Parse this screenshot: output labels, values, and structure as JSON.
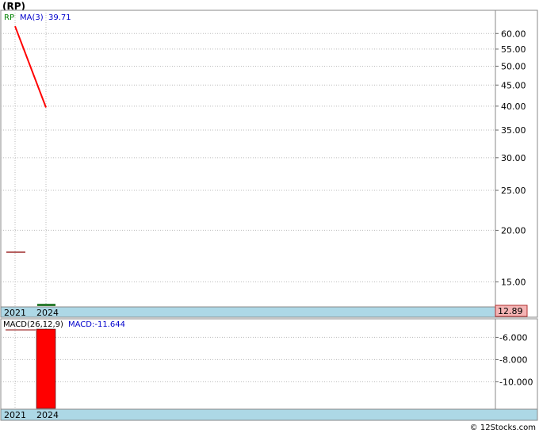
{
  "chart_data": [
    {
      "type": "line",
      "title": "(RP)",
      "legend": {
        "symbol": "RP",
        "ma_label": "MA(3)",
        "ma_value": "39.71"
      },
      "colors": {
        "price": "#8b0000",
        "ma": "#ff0000",
        "legend_symbol": "#008000",
        "legend_ma": "#0000cc",
        "band": "#add8e6",
        "last_price_bg": "#f4b4b4"
      },
      "scale": "log",
      "ylim": [
        13.1,
        68
      ],
      "y_ticks": [
        {
          "value": 60,
          "label": "60.00"
        },
        {
          "value": 55,
          "label": "55.00"
        },
        {
          "value": 50,
          "label": "50.00"
        },
        {
          "value": 45,
          "label": "45.00"
        },
        {
          "value": 40,
          "label": "40.00"
        },
        {
          "value": 35,
          "label": "35.00"
        },
        {
          "value": 30,
          "label": "30.00"
        },
        {
          "value": 25,
          "label": "25.00"
        },
        {
          "value": 20,
          "label": "20.00"
        },
        {
          "value": 15,
          "label": "15.00"
        }
      ],
      "x_labels": [
        "2021",
        "2024"
      ],
      "series": [
        {
          "name": "RP",
          "points": [
            {
              "x": "2021",
              "y": 17.7
            }
          ]
        },
        {
          "name": "MA(3)",
          "points": [
            {
              "x": "2021",
              "y": 62.5
            },
            {
              "x": "2024",
              "y": 39.71
            }
          ]
        }
      ],
      "last_price": "12.89",
      "grid": true
    },
    {
      "type": "bar",
      "title": "MACD(26,12,9)",
      "value_label": "MACD:-11.644",
      "colors": {
        "bar": "#ff0000",
        "label": "#0000cc",
        "band": "#add8e6"
      },
      "ylim": [
        -12.4,
        -4.4
      ],
      "y_ticks": [
        {
          "value": -6,
          "label": "-6.000"
        },
        {
          "value": -8,
          "label": "-8.000"
        },
        {
          "value": -10,
          "label": "-10.000"
        }
      ],
      "x_labels": [
        "2021",
        "2024"
      ],
      "series": [
        {
          "name": "MACD",
          "points": [
            {
              "x": "2024",
              "y": -11.644
            }
          ]
        }
      ],
      "grid": true
    }
  ],
  "footer": {
    "credit": "© 12Stocks.com"
  }
}
